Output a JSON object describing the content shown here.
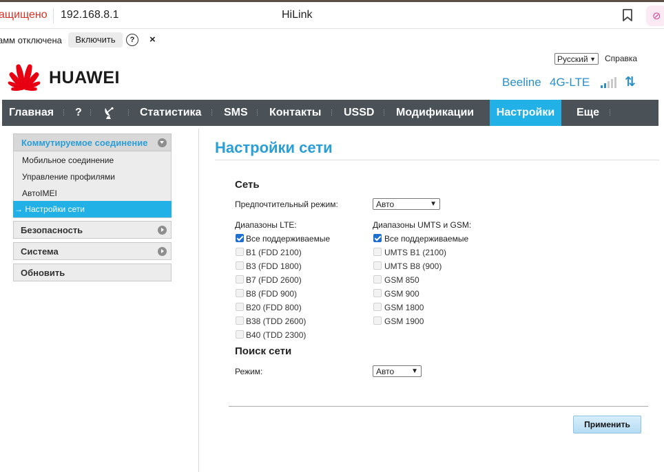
{
  "browser": {
    "security": "ащищено",
    "url": "192.168.8.1",
    "title": "HiLink"
  },
  "infobar": {
    "text": "амм отключена",
    "enable_label": "Включить",
    "help": "?",
    "close": "×"
  },
  "header": {
    "language": "Русский",
    "help_link": "Справка",
    "brand": "HUAWEI",
    "operator": "Beeline",
    "network_type": "4G-LTE",
    "updown": "⇅",
    "brand_color": "#e60012",
    "accent": "#21b1e6"
  },
  "nav": {
    "items": [
      "Главная",
      "?",
      "",
      "Статистика",
      "SMS",
      "Контакты",
      "USSD",
      "Модификации",
      "Настройки",
      "Еще"
    ],
    "active": "Настройки"
  },
  "sidebar": {
    "group": "Коммутируемое соединение",
    "subitems": [
      "Мобильное соединение",
      "Управление профилями",
      "АвтоIMEI"
    ],
    "active_item": "→ Настройки сети",
    "sections": [
      "Безопасность",
      "Система"
    ],
    "update": "Обновить"
  },
  "main": {
    "title": "Настройки сети",
    "network_section": "Сеть",
    "preferred_mode_label": "Предпочтительный режим:",
    "preferred_mode_value": "Авто",
    "lte_label": "Диапазоны LTE:",
    "umts_label": "Диапазоны UMTS и GSM:",
    "lte_bands": [
      {
        "label": "Все поддерживаемые",
        "checked": true
      },
      {
        "label": "B1 (FDD 2100)",
        "checked": false
      },
      {
        "label": "B3 (FDD 1800)",
        "checked": false
      },
      {
        "label": "B7 (FDD 2600)",
        "checked": false
      },
      {
        "label": "B8 (FDD 900)",
        "checked": false
      },
      {
        "label": "B20 (FDD 800)",
        "checked": false
      },
      {
        "label": "B38 (TDD 2600)",
        "checked": false
      },
      {
        "label": "B40 (TDD 2300)",
        "checked": false
      }
    ],
    "umts_bands": [
      {
        "label": "Все поддерживаемые",
        "checked": true
      },
      {
        "label": "UMTS B1 (2100)",
        "checked": false
      },
      {
        "label": "UMTS B8 (900)",
        "checked": false
      },
      {
        "label": "GSM 850",
        "checked": false
      },
      {
        "label": "GSM 900",
        "checked": false
      },
      {
        "label": "GSM 1800",
        "checked": false
      },
      {
        "label": "GSM 1900",
        "checked": false
      }
    ],
    "search_section": "Поиск сети",
    "search_mode_label": "Режим:",
    "search_mode_value": "Авто",
    "apply_label": "Применить"
  }
}
